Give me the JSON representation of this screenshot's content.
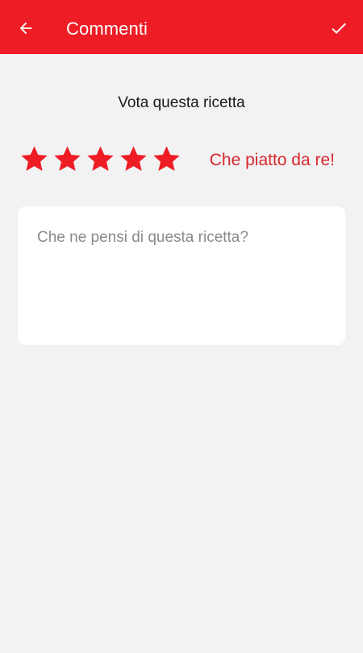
{
  "app_bar": {
    "title": "Commenti",
    "back_icon": "arrow-left-icon",
    "confirm_icon": "checkmark-icon",
    "background_color": "#ee1c25"
  },
  "rating": {
    "heading": "Vota questa ricetta",
    "value": 5,
    "max": 5,
    "label": "Che piatto da re!",
    "star_color": "#ee1c25"
  },
  "comment": {
    "placeholder": "Che ne pensi di questa ricetta?",
    "value": ""
  }
}
